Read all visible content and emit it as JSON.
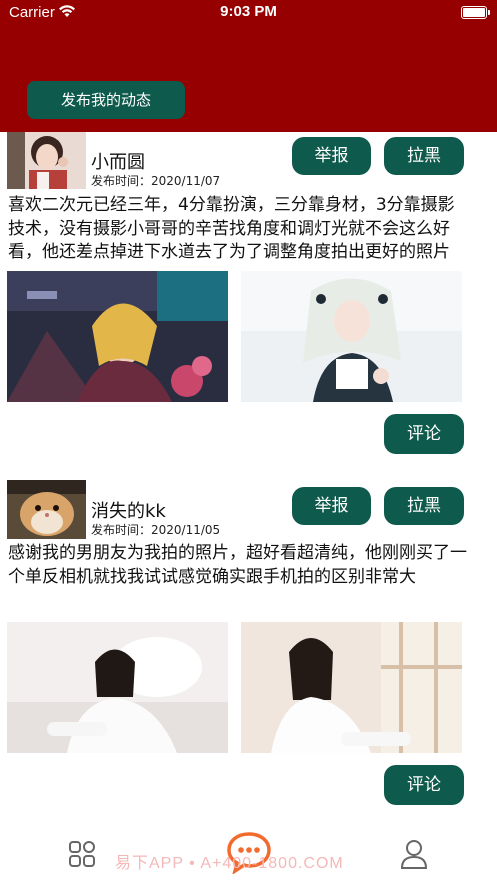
{
  "status_bar": {
    "carrier": "Carrier",
    "time": "9:03 PM"
  },
  "header": {
    "publish_label": "发布我的动态"
  },
  "posts": [
    {
      "username": "小而圆",
      "time": "发布时间：2020/11/07",
      "report_label": "举报",
      "block_label": "拉黑",
      "text": "喜欢二次元已经三年，4分靠扮演，三分靠身材，3分靠摄影技术，没有摄影小哥哥的辛苦找角度和调灯光就不会这么好看，他还差点掉进下水道去了为了调整角度拍出更好的照片",
      "comment_label": "评论"
    },
    {
      "username": "消失的kk",
      "time": "发布时间：2020/11/05",
      "report_label": "举报",
      "block_label": "拉黑",
      "text": "感谢我的男朋友为我拍的照片，超好看超清纯，他刚刚买了一个单反相机就找我试试感觉确实跟手机拍的区别非常大",
      "comment_label": "评论"
    }
  ],
  "tabbar": {
    "items": [
      "grid-icon",
      "chat-bubble-icon",
      "person-icon"
    ],
    "active_color": "#f26a2e",
    "watermark": "易下APP • A+400-1800.COM"
  },
  "colors": {
    "header": "#960000",
    "button": "#0e5a4c"
  }
}
